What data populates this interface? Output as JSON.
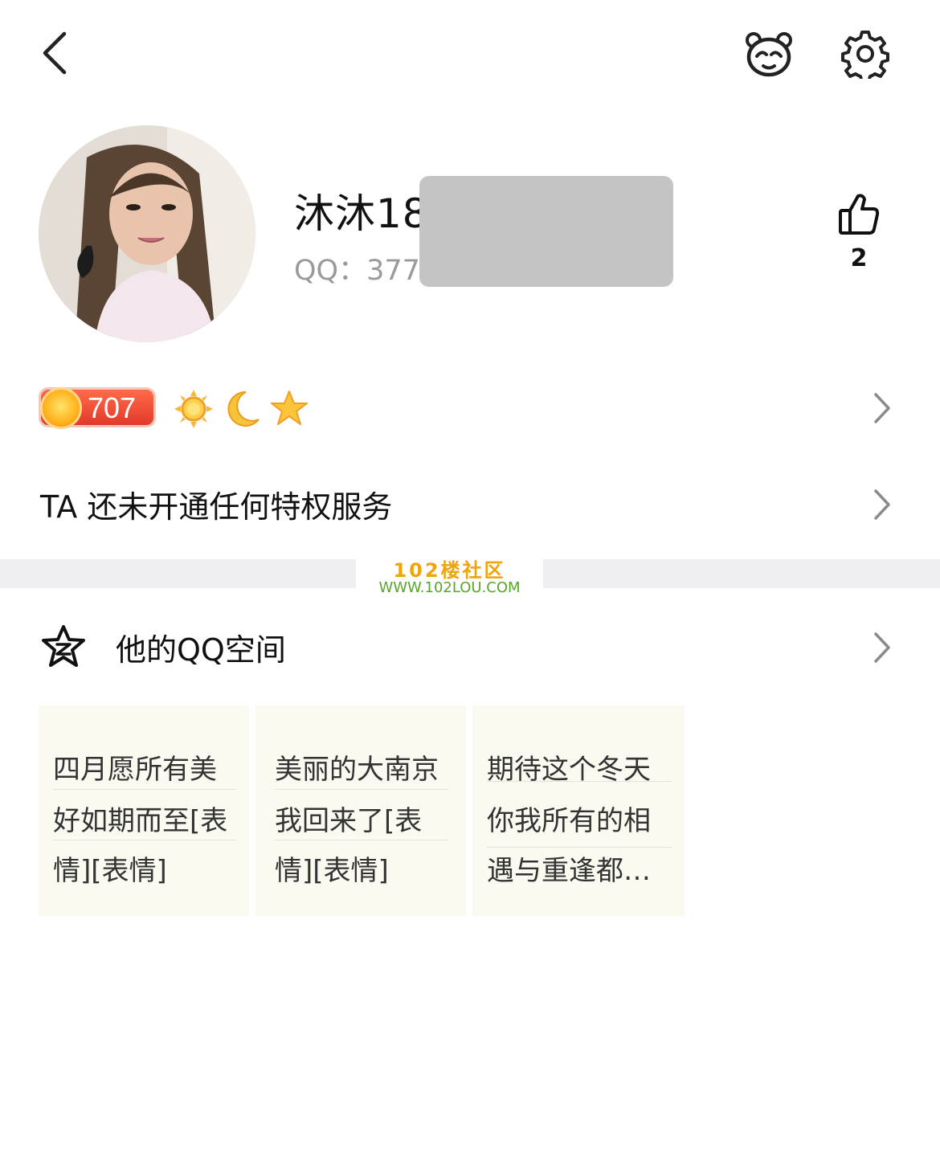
{
  "profile": {
    "nickname": "沐沐18",
    "qq_label": "QQ：",
    "qq_number": "377",
    "like_count": "2"
  },
  "level": {
    "value": "707"
  },
  "privilege": {
    "text": "TA 还未开通任何特权服务"
  },
  "watermark": {
    "line1": "102楼社区",
    "line2": "WWW.102LOU.COM"
  },
  "qzone": {
    "title": "他的QQ空间",
    "cards": [
      {
        "lines": [
          "四月愿所有美",
          "好如期而至[表",
          "情][表情]"
        ]
      },
      {
        "lines": [
          "美丽的大南京",
          "我回来了[表",
          "情][表情]"
        ]
      },
      {
        "lines": [
          "期待这个冬天",
          "你我所有的相",
          "遇与重逢都…"
        ]
      }
    ]
  }
}
